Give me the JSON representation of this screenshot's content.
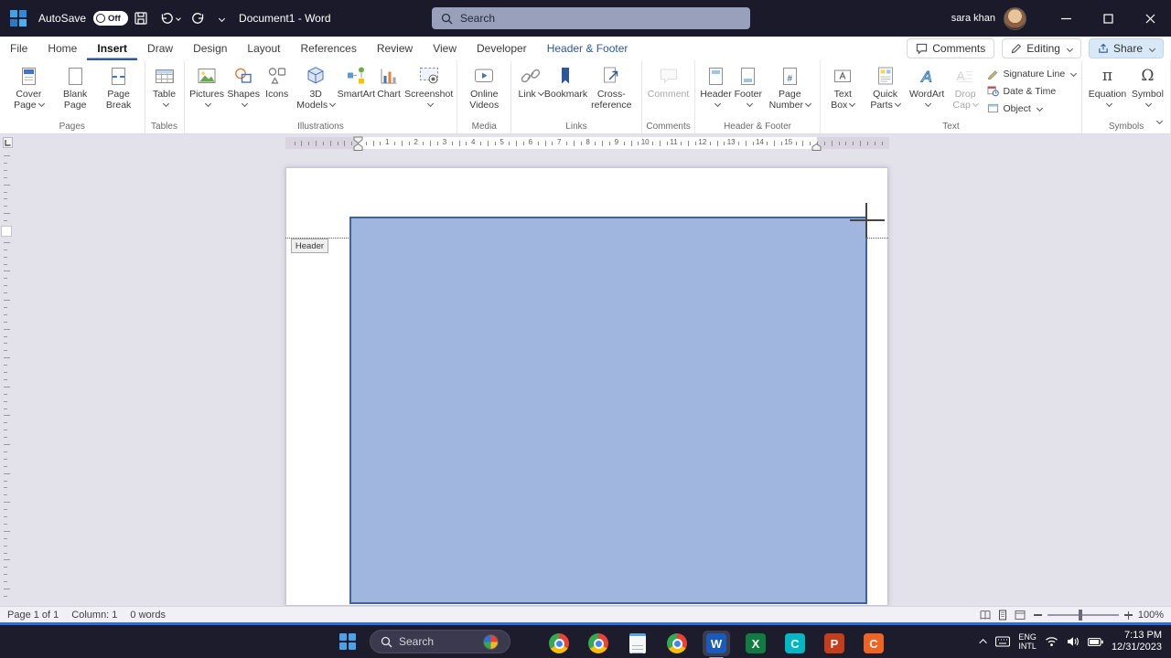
{
  "theme": {
    "titlebar_bg": "#1b1a2b",
    "tab_accent": "#2b579a",
    "doc_bg": "#e3e1ea",
    "shape_fill": "#a0b6de",
    "shape_border": "#3f639e",
    "status_accent": "#2b6be8",
    "taskbar_bg": "#1d1c2d",
    "word_blue": "#185abd",
    "excel_green": "#107c41",
    "ppt_orange": "#c43e1c"
  },
  "titlebar": {
    "autosave_label": "AutoSave",
    "autosave_state": "Off",
    "doc_title": "Document1 - Word",
    "search_placeholder": "Search",
    "user_name": "sara khan"
  },
  "tabs": {
    "items": [
      "File",
      "Home",
      "Insert",
      "Draw",
      "Design",
      "Layout",
      "References",
      "Review",
      "View",
      "Developer",
      "Header & Footer"
    ],
    "active": "Insert",
    "comments": "Comments",
    "editing": "Editing",
    "share": "Share"
  },
  "ribbon": {
    "groups": [
      {
        "label": "Pages",
        "buttons": [
          {
            "label": "Cover Page"
          },
          {
            "label": "Blank Page"
          },
          {
            "label": "Page Break"
          }
        ]
      },
      {
        "label": "Tables",
        "buttons": [
          {
            "label": "Table"
          }
        ]
      },
      {
        "label": "Illustrations",
        "buttons": [
          {
            "label": "Pictures"
          },
          {
            "label": "Shapes"
          },
          {
            "label": "Icons"
          },
          {
            "label": "3D Models"
          },
          {
            "label": "SmartArt"
          },
          {
            "label": "Chart"
          },
          {
            "label": "Screenshot"
          }
        ]
      },
      {
        "label": "Media",
        "buttons": [
          {
            "label": "Online Videos"
          }
        ]
      },
      {
        "label": "Links",
        "buttons": [
          {
            "label": "Link"
          },
          {
            "label": "Bookmark"
          },
          {
            "label": "Cross-reference"
          }
        ]
      },
      {
        "label": "Comments",
        "buttons": [
          {
            "label": "Comment"
          }
        ]
      },
      {
        "label": "Header & Footer",
        "buttons": [
          {
            "label": "Header"
          },
          {
            "label": "Footer"
          },
          {
            "label": "Page Number"
          }
        ]
      },
      {
        "label": "Text",
        "buttons": [
          {
            "label": "Text Box"
          },
          {
            "label": "Quick Parts"
          },
          {
            "label": "WordArt"
          },
          {
            "label": "Drop Cap"
          }
        ],
        "stacked": [
          {
            "label": "Signature Line"
          },
          {
            "label": "Date & Time"
          },
          {
            "label": "Object"
          }
        ]
      },
      {
        "label": "Symbols",
        "buttons": [
          {
            "label": "Equation"
          },
          {
            "label": "Symbol"
          }
        ]
      }
    ],
    "icons": {
      "equation_glyph": "π",
      "symbol_glyph": "Ω"
    }
  },
  "ruler": {
    "numbers": [
      1,
      2,
      3,
      4,
      5,
      6,
      7,
      8,
      9,
      10,
      11,
      12,
      13,
      14,
      15
    ]
  },
  "document": {
    "header_tag": "Header"
  },
  "statusbar": {
    "page": "Page 1 of 1",
    "column": "Column: 1",
    "words": "0 words",
    "zoom": "100%"
  },
  "taskbar": {
    "search_placeholder": "Search",
    "app_letters": {
      "word": "W",
      "excel": "X",
      "clip": "C",
      "ppt": "P",
      "c2": "C"
    },
    "tray": {
      "lang_top": "ENG",
      "lang_bottom": "INTL",
      "time": "7:13 PM",
      "date": "12/31/2023"
    }
  }
}
